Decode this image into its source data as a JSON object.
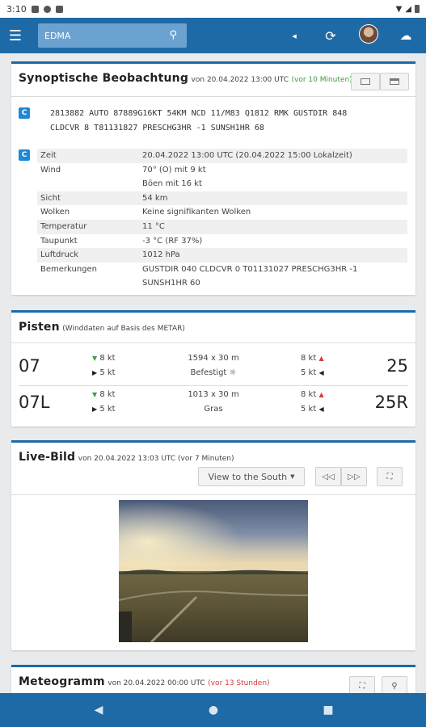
{
  "status": {
    "time": "3:10"
  },
  "appbar": {
    "search_value": "EDMA"
  },
  "synop": {
    "title": "Synoptische Beobachtung",
    "sub_prefix": "von 20.04.2022 13:00 UTC",
    "sub_age": "(vor 10 Minuten)",
    "badge": "C",
    "metar_line1": "2813882 AUTO 87889G16KT 54KM NCD 11/M83 Q1812 RMK GUSTDIR 848",
    "metar_line2": "CLDCVR 8 T81131827 PRESCHG3HR -1 SUNSH1HR 68",
    "rows": [
      {
        "k": "Zeit",
        "v": "20.04.2022 13:00 UTC (20.04.2022 15:00 Lokalzeit)"
      },
      {
        "k": "Wind",
        "v": "70° (O) mit 9 kt"
      },
      {
        "k": "",
        "v": "Böen mit 16 kt"
      },
      {
        "k": "Sicht",
        "v": "54 km"
      },
      {
        "k": "Wolken",
        "v": "Keine signifikanten Wolken"
      },
      {
        "k": "Temperatur",
        "v": "11 °C"
      },
      {
        "k": "Taupunkt",
        "v": "-3 °C (RF 37%)"
      },
      {
        "k": "Luftdruck",
        "v": "1012 hPa"
      },
      {
        "k": "Bemerkungen",
        "v": "GUSTDIR 040 CLDCVR 0 T01131027 PRESCHG3HR -1"
      },
      {
        "k": "",
        "v": "SUNSH1HR 60"
      }
    ]
  },
  "pisten": {
    "title": "Pisten",
    "sub": "(Winddaten auf Basis des METAR)",
    "runways": [
      {
        "left": "07",
        "right": "25",
        "lh": "8 kt",
        "lx": "5 kt",
        "dims": "1594 x 30 m",
        "surface": "Befestigt",
        "rh": "8 kt",
        "rx": "5 kt"
      },
      {
        "left": "07L",
        "right": "25R",
        "lh": "8 kt",
        "lx": "5 kt",
        "dims": "1013 x 30 m",
        "surface": "Gras",
        "rh": "8 kt",
        "rx": "5 kt"
      }
    ]
  },
  "live": {
    "title": "Live-Bild",
    "sub": "von 20.04.2022 13:03 UTC (vor 7 Minuten)",
    "view_label": "View to the South"
  },
  "meteo": {
    "title": "Meteogramm",
    "sub_prefix": "von 20.04.2022 00:00 UTC",
    "sub_age": "(vor 13 Stunden)"
  }
}
